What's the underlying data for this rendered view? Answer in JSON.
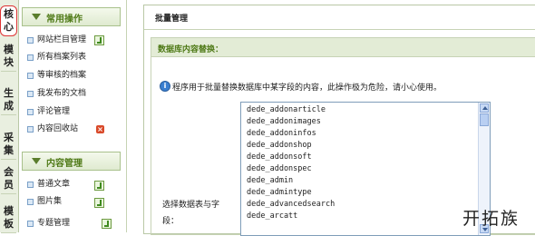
{
  "vtabs": [
    "核心",
    "模块",
    "生成",
    "采集",
    "会员",
    "模板"
  ],
  "sidebar": {
    "group1_title": "常用操作",
    "group1_items": [
      "网站栏目管理",
      "所有档案列表",
      "等审核的档案",
      "我发布的文档",
      "评论管理",
      "内容回收站"
    ],
    "group2_title": "内容管理",
    "group2_items": [
      "普通文章",
      "图片集",
      "专题管理"
    ]
  },
  "main": {
    "header_title": "批量管理",
    "section_title": "数据库内容替换：",
    "info_text": "程序用于批量替换数据库中某字段的内容，此操作极为危险，请小心使用。",
    "select_label": "选择数据表与字段：",
    "tables": [
      "dede_addonarticle",
      "dede_addonimages",
      "dede_addoninfos",
      "dede_addonshop",
      "dede_addonsoft",
      "dede_addonspec",
      "dede_admin",
      "dede_admintype",
      "dede_advancedsearch",
      "dede_arcatt"
    ]
  },
  "watermark": "开拓族",
  "colors": {
    "accent_green": "#4f7a17",
    "panel_bg": "#e3ecd6",
    "border": "#b9c8a6"
  }
}
